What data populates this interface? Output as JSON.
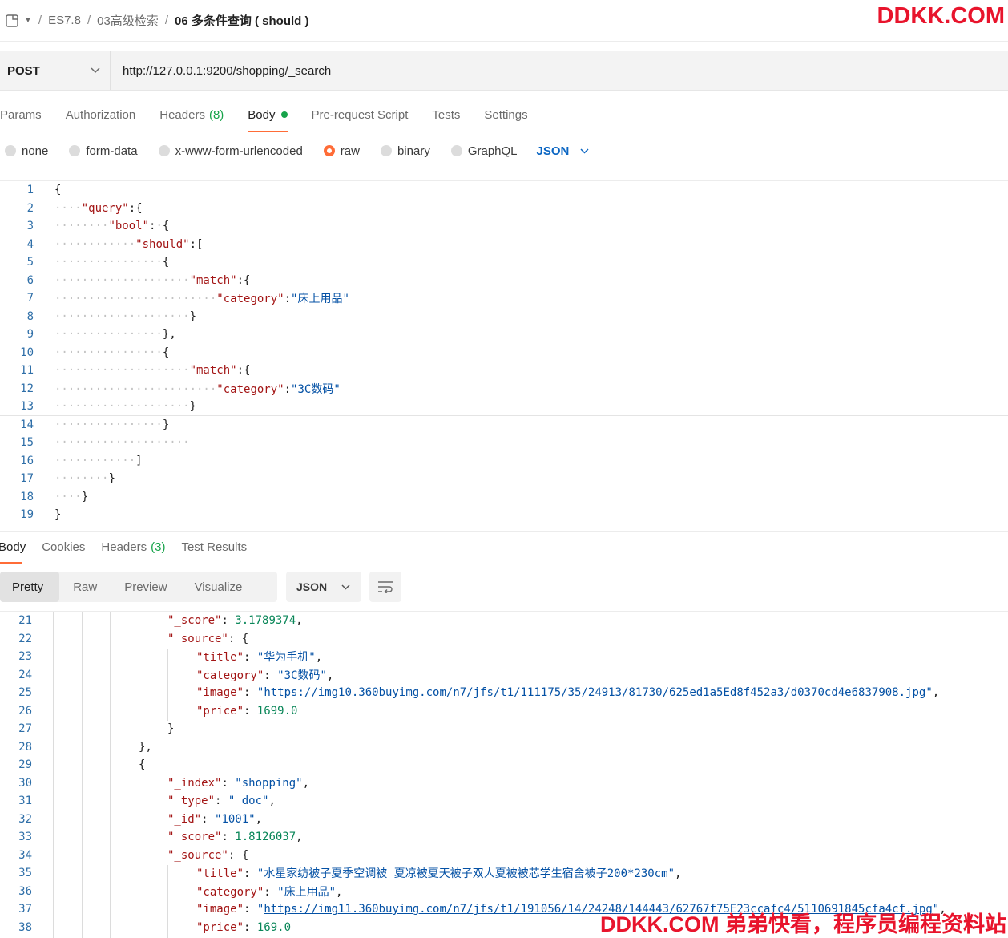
{
  "breadcrumb": {
    "items": [
      "ES7.8",
      "03高级检索"
    ],
    "current": "06 多条件查询 ( should )"
  },
  "watermark": {
    "top": "DDKK.COM",
    "bottom": "DDKK.COM 弟弟快看，程序员编程资料站"
  },
  "request": {
    "method": "POST",
    "url": "http://127.0.0.1:9200/shopping/_search"
  },
  "request_tabs": {
    "params": "Params",
    "authorization": "Authorization",
    "headers": "Headers",
    "headers_count": "(8)",
    "body": "Body",
    "prerequest": "Pre-request Script",
    "tests": "Tests",
    "settings": "Settings"
  },
  "body_types": {
    "none": "none",
    "form_data": "form-data",
    "urlencoded": "x-www-form-urlencoded",
    "raw": "raw",
    "binary": "binary",
    "graphql": "GraphQL",
    "format": "JSON"
  },
  "request_body": {
    "line_numbers": [
      "1",
      "2",
      "3",
      "4",
      "5",
      "6",
      "7",
      "8",
      "9",
      "10",
      "11",
      "12",
      "13",
      "14",
      "15",
      "16",
      "17",
      "18",
      "19"
    ],
    "k_query": "\"query\"",
    "k_bool": "\"bool\"",
    "k_should": "\"should\"",
    "k_match": "\"match\"",
    "k_category": "\"category\"",
    "v_bedding": "\"床上用品\"",
    "v_digital": "\"3C数码\""
  },
  "response_tabs": {
    "body": "Body",
    "cookies": "Cookies",
    "headers": "Headers",
    "headers_count": "(3)",
    "test_results": "Test Results"
  },
  "response_toolbar": {
    "pretty": "Pretty",
    "raw": "Raw",
    "preview": "Preview",
    "visualize": "Visualize",
    "format": "JSON"
  },
  "response_body": {
    "line_numbers": [
      "21",
      "22",
      "23",
      "24",
      "25",
      "26",
      "27",
      "28",
      "29",
      "30",
      "31",
      "32",
      "33",
      "34",
      "35",
      "36",
      "37",
      "38"
    ],
    "k_score": "\"_score\"",
    "k_source": "\"_source\"",
    "k_title": "\"title\"",
    "k_category": "\"category\"",
    "k_image": "\"image\"",
    "k_price": "\"price\"",
    "k_index": "\"_index\"",
    "k_type": "\"_type\"",
    "k_id": "\"_id\"",
    "score1": "3.1789374",
    "title1": "\"华为手机\"",
    "category1": "\"3C数码\"",
    "image1": "https://img10.360buyimg.com/n7/jfs/t1/111175/35/24913/81730/625ed1a5Ed8f452a3/d0370cd4e6837908.jpg",
    "price1": "1699.0",
    "index2": "\"shopping\"",
    "type2": "\"_doc\"",
    "id2": "\"1001\"",
    "score2": "1.8126037",
    "title2": "\"水星家纺被子夏季空调被 夏凉被夏天被子双人夏被被芯学生宿舍被子200*230cm\"",
    "category2": "\"床上用品\"",
    "image2": "https://img11.360buyimg.com/n7/jfs/t1/191056/14/24248/144443/62767f75E23ccafc4/5110691845cfa4cf.jpg",
    "price2": "169.0"
  }
}
